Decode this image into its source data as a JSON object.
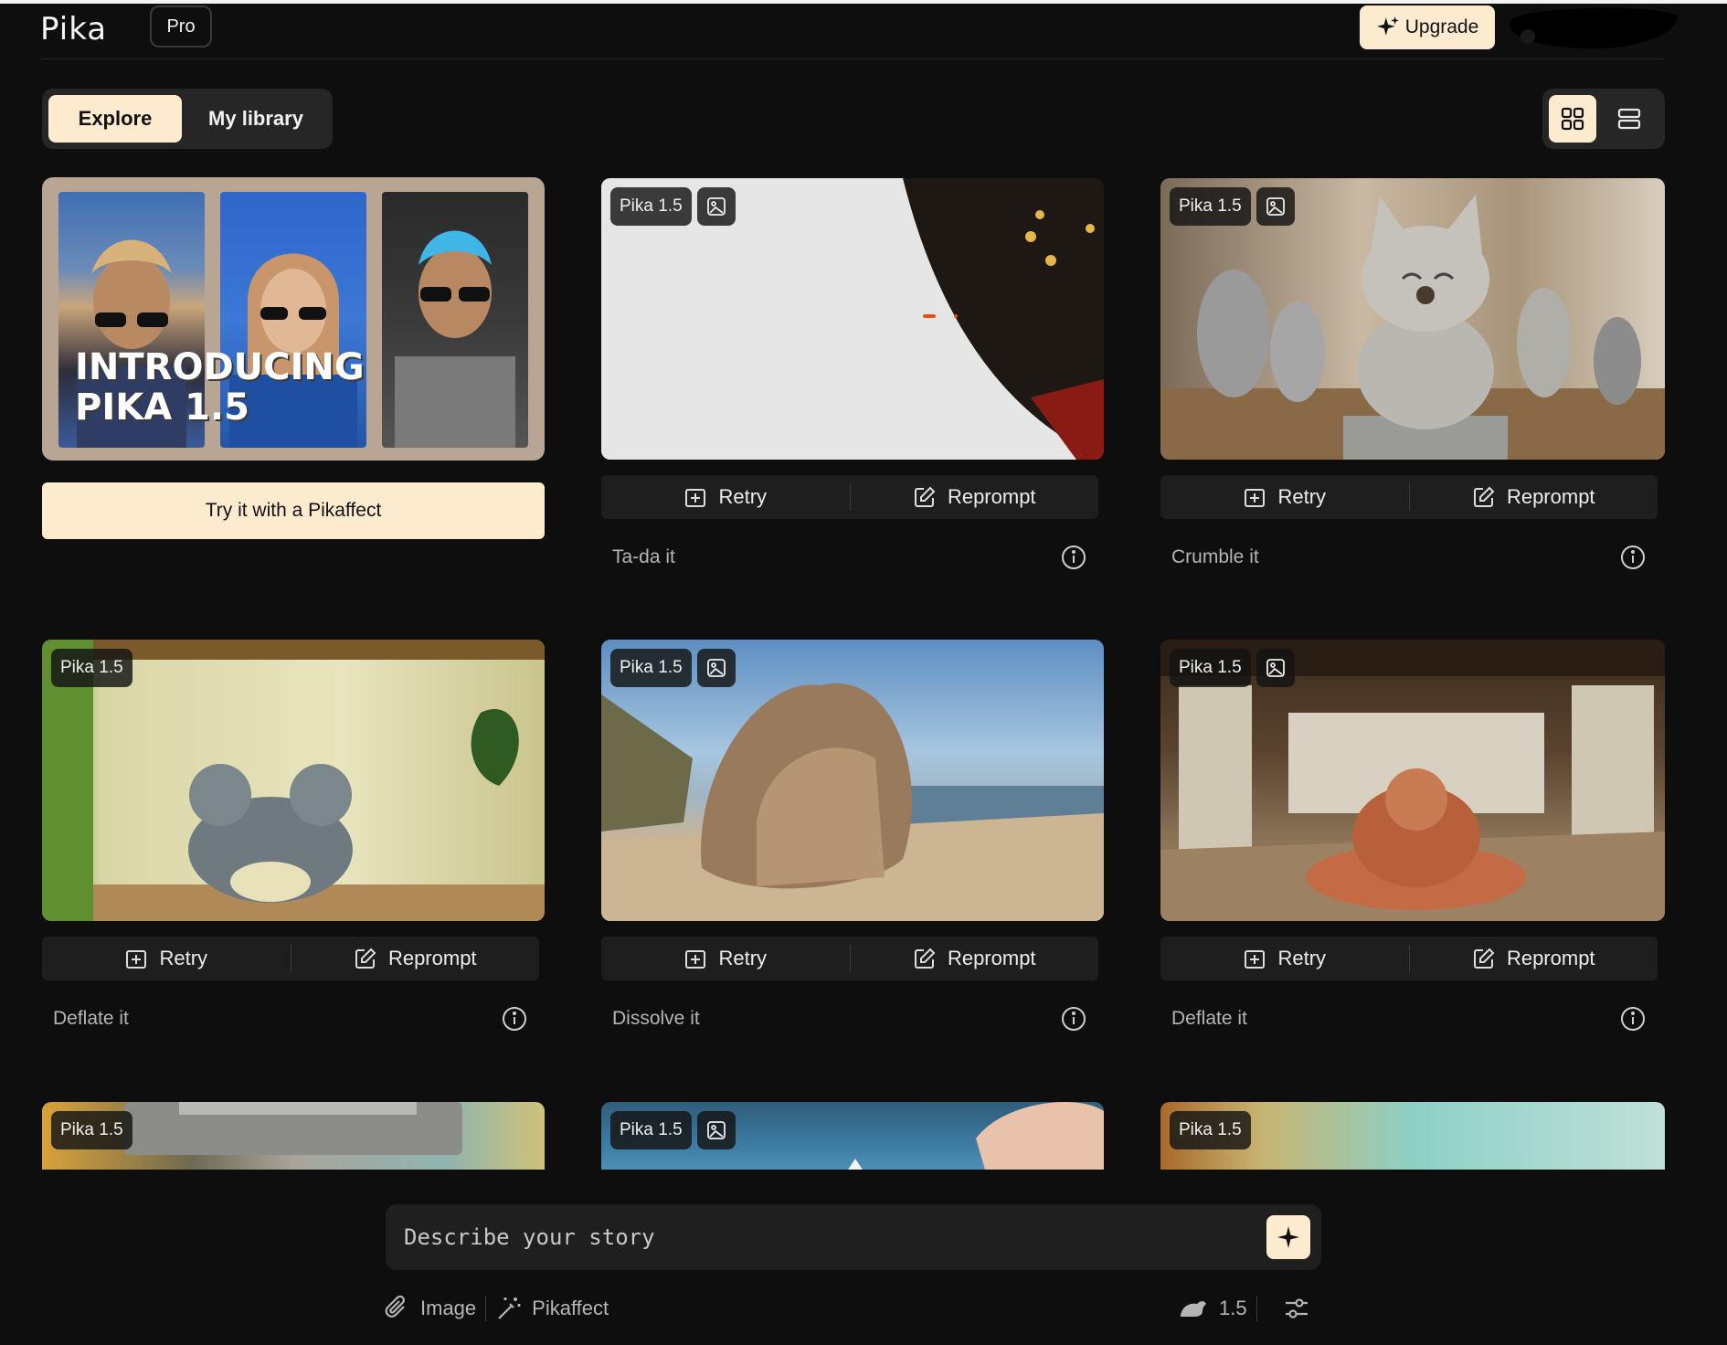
{
  "header": {
    "logo": "Pika",
    "plan_badge": "Pro",
    "upgrade_label": "Upgrade"
  },
  "tabs": [
    {
      "label": "Explore",
      "active": true
    },
    {
      "label": "My library",
      "active": false
    }
  ],
  "view_modes": [
    {
      "icon": "grid-view-icon",
      "active": true
    },
    {
      "icon": "list-view-icon",
      "active": false
    }
  ],
  "promo": {
    "title_line1": "INTRODUCING",
    "title_line2": "PIKA 1.5",
    "cta_label": "Try it with a Pikaffect"
  },
  "cards": [
    {
      "model": "Pika 1.5",
      "has_image_input": true,
      "caption": "Ta-da it",
      "retry": "Retry",
      "reprompt": "Reprompt"
    },
    {
      "model": "Pika 1.5",
      "has_image_input": true,
      "caption": "Crumble it",
      "retry": "Retry",
      "reprompt": "Reprompt"
    },
    {
      "model": "Pika 1.5",
      "has_image_input": false,
      "caption": "Deflate it",
      "retry": "Retry",
      "reprompt": "Reprompt"
    },
    {
      "model": "Pika 1.5",
      "has_image_input": true,
      "caption": "Dissolve it",
      "retry": "Retry",
      "reprompt": "Reprompt"
    },
    {
      "model": "Pika 1.5",
      "has_image_input": true,
      "caption": "Deflate it",
      "retry": "Retry",
      "reprompt": "Reprompt"
    },
    {
      "model": "Pika 1.5",
      "has_image_input": false
    },
    {
      "model": "Pika 1.5",
      "has_image_input": true
    },
    {
      "model": "Pika 1.5",
      "has_image_input": false
    }
  ],
  "prompt": {
    "placeholder": "Describe your story"
  },
  "toolbar": {
    "image_label": "Image",
    "pikaffect_label": "Pikaffect",
    "model_version": "1.5"
  },
  "colors": {
    "background": "#0e0e0e",
    "accent": "#fdebd0",
    "surface": "#1e1e1e"
  }
}
